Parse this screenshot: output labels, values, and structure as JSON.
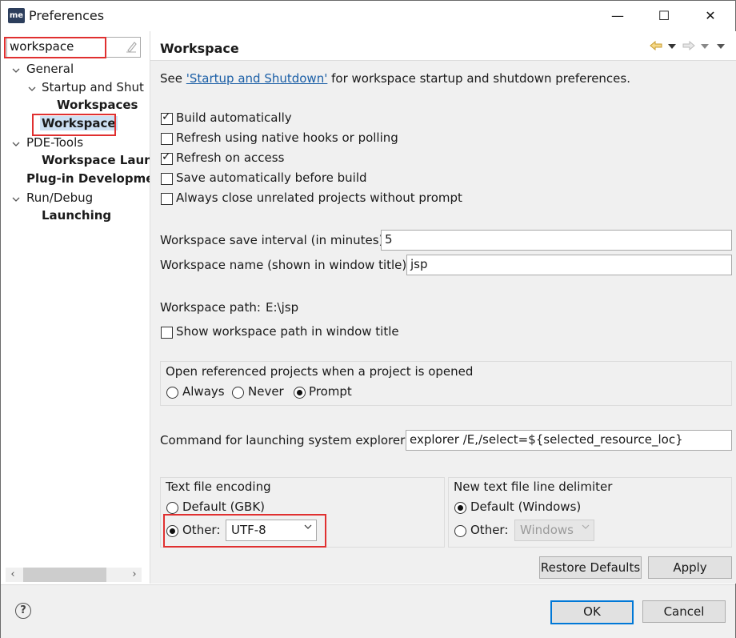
{
  "window": {
    "title": "Preferences",
    "app_icon": "me",
    "minimize": "—",
    "maximize": "☐",
    "close": "✕"
  },
  "filter": {
    "value": "workspace"
  },
  "tree": {
    "general": "General",
    "startup": "Startup and Shut",
    "workspaces": "Workspaces",
    "workspace": "Workspace",
    "pde": "PDE-Tools",
    "workspace_launch": "Workspace Laun",
    "plugin_dev": "Plug-in Developme",
    "run_debug": "Run/Debug",
    "launching": "Launching"
  },
  "page": {
    "title": "Workspace",
    "see_prefix": "See",
    "see_link": "'Startup and Shutdown'",
    "see_suffix": "for workspace startup and shutdown preferences.",
    "checkboxes": [
      {
        "label": "Build automatically",
        "checked": true
      },
      {
        "label": "Refresh using native hooks or polling",
        "checked": false
      },
      {
        "label": "Refresh on access",
        "checked": true
      },
      {
        "label": "Save automatically before build",
        "checked": false
      },
      {
        "label": "Always close unrelated projects without prompt",
        "checked": false
      }
    ],
    "save_interval_label": "Workspace save interval (in minutes):",
    "save_interval_value": "5",
    "ws_name_label": "Workspace name (shown in window title):",
    "ws_name_value": "jsp",
    "ws_path_label": "Workspace path:",
    "ws_path_value": "E:\\jsp",
    "show_path_label": "Show workspace path in window title",
    "open_ref_label": "Open referenced projects when a project is opened",
    "open_ref_options": [
      "Always",
      "Never",
      "Prompt"
    ],
    "open_ref_selected": "Prompt",
    "explorer_label": "Command for launching system explorer:",
    "explorer_value": "explorer /E,/select=${selected_resource_loc}",
    "encoding_label": "Text file encoding",
    "encoding_default": "Default (GBK)",
    "encoding_other": "Other:",
    "encoding_value": "UTF-8",
    "delimiter_label": "New text file line delimiter",
    "delimiter_default": "Default (Windows)",
    "delimiter_other": "Other:",
    "delimiter_value": "Windows",
    "restore_defaults": "Restore Defaults",
    "apply": "Apply"
  },
  "footer": {
    "ok": "OK",
    "cancel": "Cancel",
    "help": "?"
  },
  "colors": {
    "highlight": "#e03030",
    "selection": "#cde0f3",
    "link": "#1a5ea6",
    "default_button": "#0078d7"
  }
}
